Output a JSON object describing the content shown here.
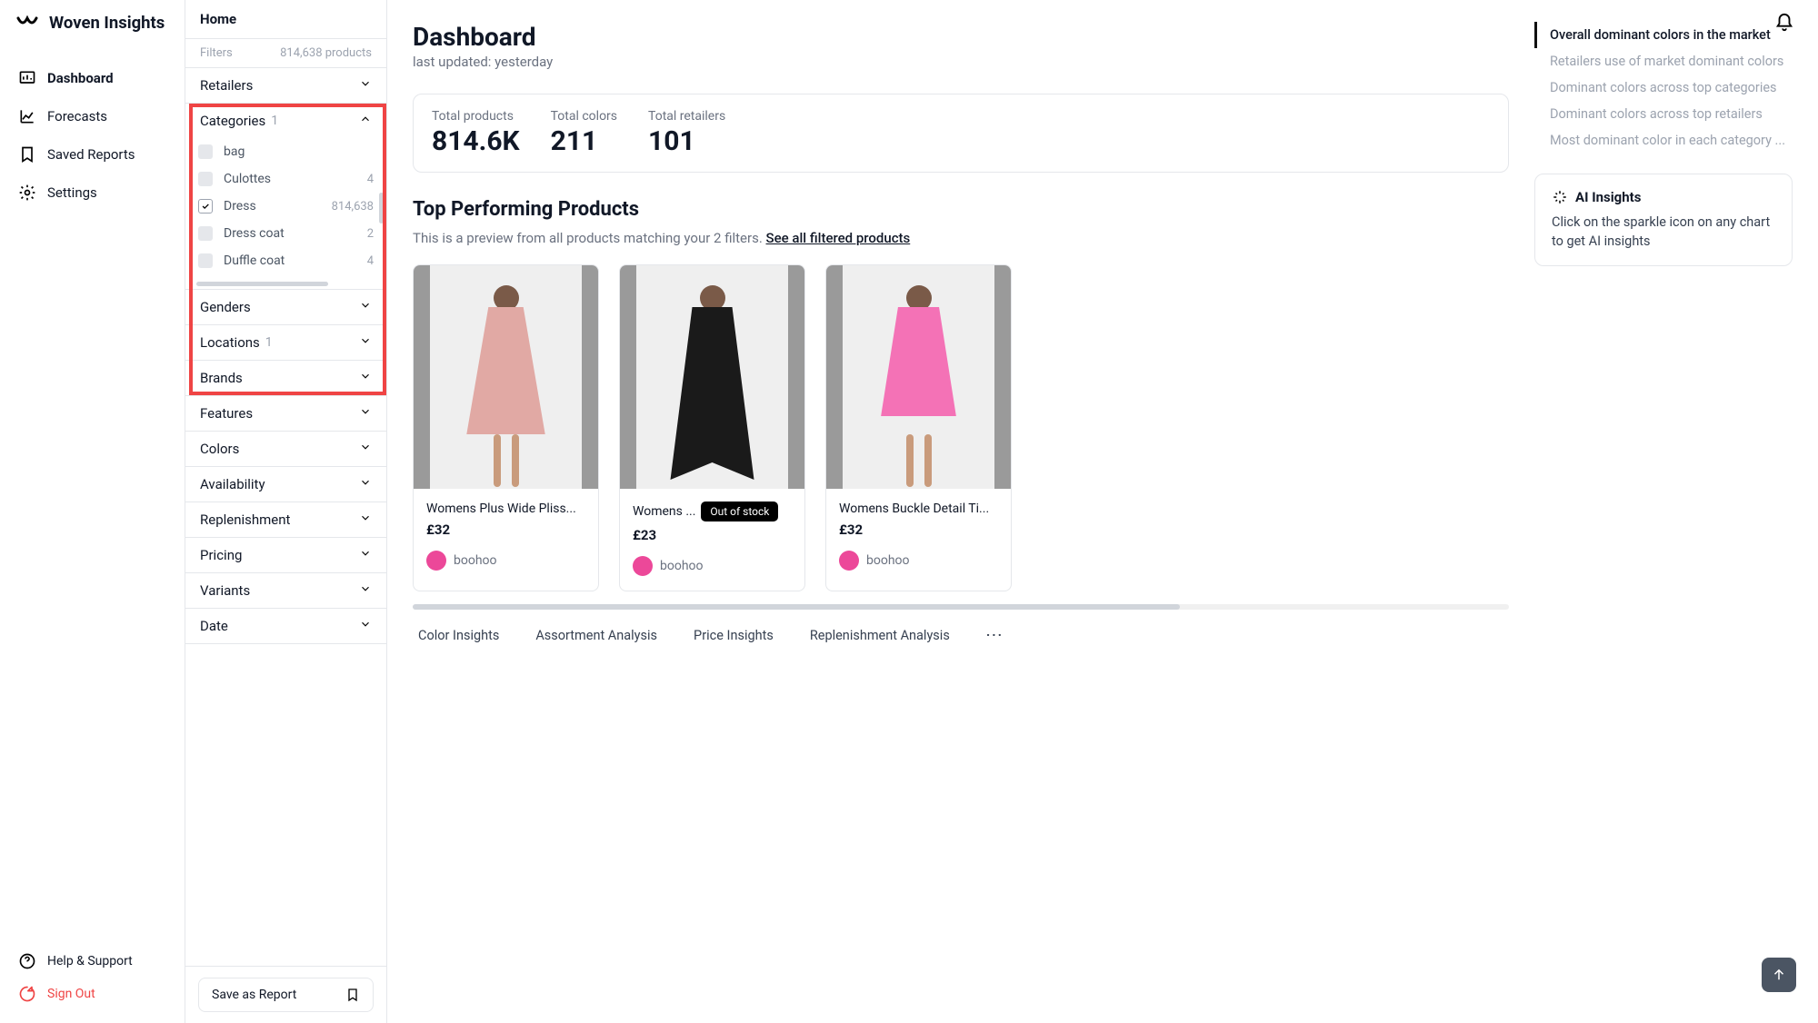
{
  "brand": "Woven Insights",
  "nav": {
    "dashboard": "Dashboard",
    "forecasts": "Forecasts",
    "saved": "Saved Reports",
    "settings": "Settings",
    "help": "Help & Support",
    "signout": "Sign Out"
  },
  "home": "Home",
  "filterHead": {
    "label": "Filters",
    "count": "814,638 products"
  },
  "filters": {
    "retailers": {
      "label": "Retailers"
    },
    "categories": {
      "label": "Categories",
      "badge": "1",
      "items": [
        {
          "label": "bag",
          "count": "",
          "checked": false
        },
        {
          "label": "Culottes",
          "count": "4",
          "checked": false
        },
        {
          "label": "Dress",
          "count": "814,638",
          "checked": true
        },
        {
          "label": "Dress coat",
          "count": "2",
          "checked": false
        },
        {
          "label": "Duffle coat",
          "count": "4",
          "checked": false
        }
      ]
    },
    "genders": {
      "label": "Genders"
    },
    "locations": {
      "label": "Locations",
      "badge": "1"
    },
    "brands": {
      "label": "Brands"
    },
    "features": {
      "label": "Features"
    },
    "colors": {
      "label": "Colors"
    },
    "availability": {
      "label": "Availability"
    },
    "replenishment": {
      "label": "Replenishment"
    },
    "pricing": {
      "label": "Pricing"
    },
    "variants": {
      "label": "Variants"
    },
    "date": {
      "label": "Date"
    }
  },
  "saveReport": "Save as Report",
  "dash": {
    "title": "Dashboard",
    "updated": "last updated: yesterday",
    "stats": [
      {
        "label": "Total products",
        "value": "814.6K"
      },
      {
        "label": "Total colors",
        "value": "211"
      },
      {
        "label": "Total retailers",
        "value": "101"
      }
    ],
    "topTitle": "Top Performing Products",
    "previewText": "This is a preview from all products matching your 2 filters. ",
    "previewLink": "See all filtered products",
    "products": [
      {
        "name": "Womens Plus Wide Pliss...",
        "price": "£32",
        "retailer": "boohoo",
        "outOfStock": false
      },
      {
        "name": "Womens ...",
        "price": "£23",
        "retailer": "boohoo",
        "outOfStock": true,
        "badge": "Out of stock"
      },
      {
        "name": "Womens Buckle Detail Ti...",
        "price": "£32",
        "retailer": "boohoo",
        "outOfStock": false
      }
    ],
    "tabs": [
      "Color Insights",
      "Assortment Analysis",
      "Price Insights",
      "Replenishment Analysis"
    ]
  },
  "rightNav": [
    "Overall dominant colors in the market",
    "Retailers use of market dominant colors",
    "Dominant colors across top categories",
    "Dominant colors across top retailers",
    "Most dominant color in each category ..."
  ],
  "ai": {
    "title": "AI Insights",
    "body": "Click on the sparkle icon on any chart to get AI insights"
  }
}
